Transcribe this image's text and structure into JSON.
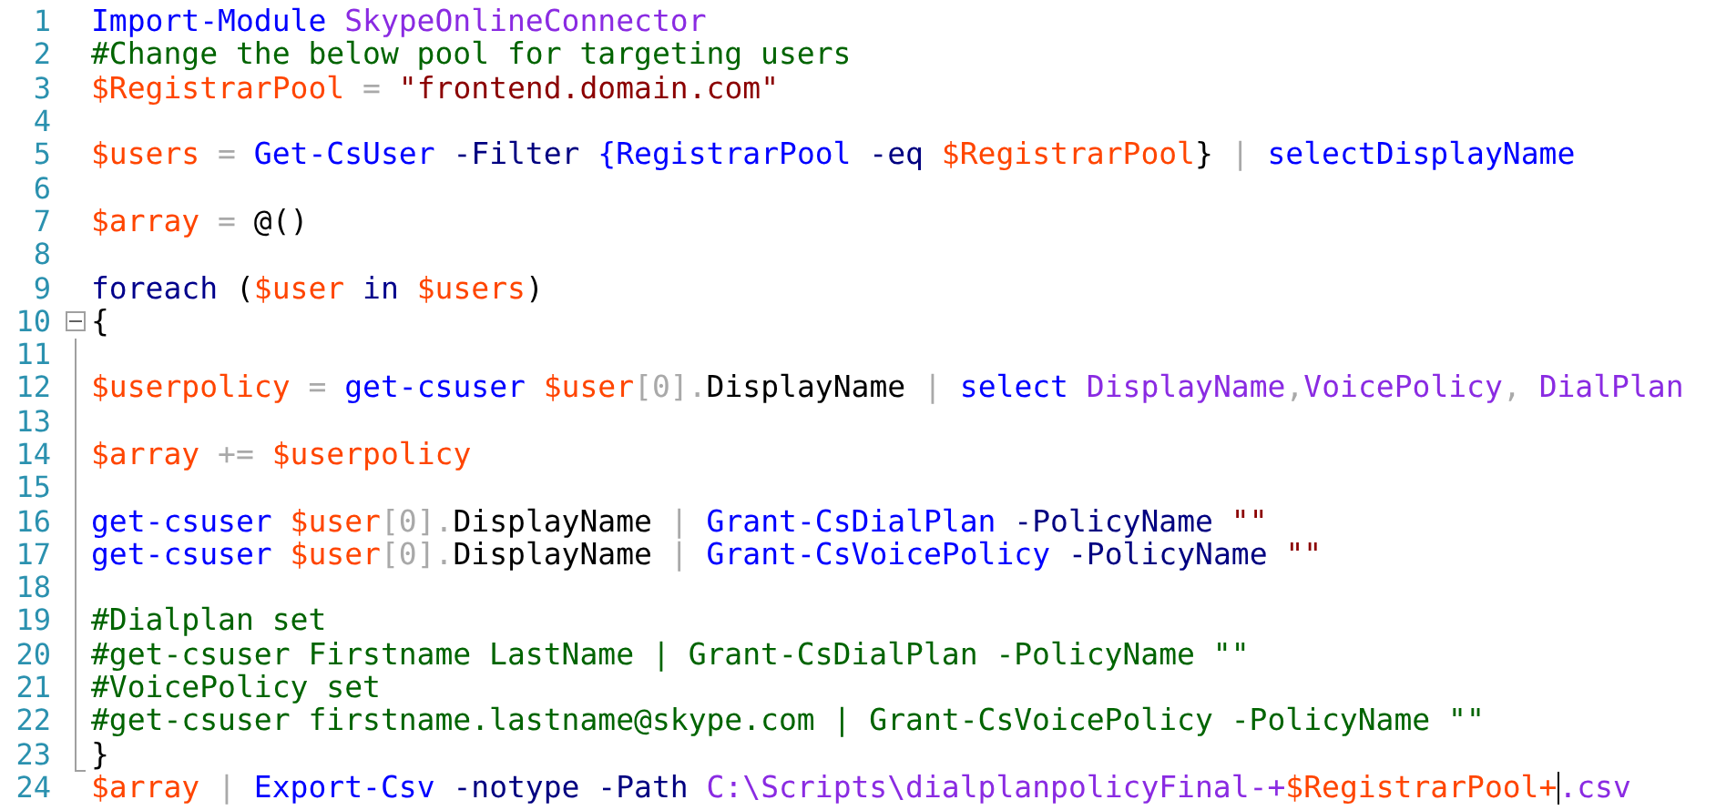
{
  "editor": {
    "lines": [
      {
        "number": "1",
        "kind": "plain",
        "tokens": [
          {
            "kind": "command",
            "text": "Import-Module"
          },
          {
            "kind": "argument",
            "text": " SkypeOnlineConnector"
          }
        ]
      },
      {
        "number": "2",
        "kind": "plain",
        "tokens": [
          {
            "kind": "comment",
            "text": "#Change the below pool for targeting users"
          }
        ]
      },
      {
        "number": "3",
        "kind": "plain",
        "tokens": [
          {
            "kind": "variable",
            "text": "$RegistrarPool"
          },
          {
            "kind": "operator",
            "text": " = "
          },
          {
            "kind": "string",
            "text": "\"frontend.domain.com\""
          }
        ]
      },
      {
        "number": "4",
        "kind": "plain"
      },
      {
        "number": "5",
        "kind": "plain",
        "tokens": [
          {
            "kind": "variable",
            "text": "$users"
          },
          {
            "kind": "operator",
            "text": " = "
          },
          {
            "kind": "command",
            "text": "Get-CsUser"
          },
          {
            "kind": "parameter",
            "text": " -Filter "
          },
          {
            "kind": "command",
            "text": "{RegistrarPool"
          },
          {
            "kind": "parameter",
            "text": " -eq "
          },
          {
            "kind": "variable",
            "text": "$RegistrarPool"
          },
          {
            "kind": "plain",
            "text": "}"
          },
          {
            "kind": "operator",
            "text": " | "
          },
          {
            "kind": "command",
            "text": "selectDisplayName"
          }
        ]
      },
      {
        "number": "6",
        "kind": "plain"
      },
      {
        "number": "7",
        "kind": "plain",
        "tokens": [
          {
            "kind": "variable",
            "text": "$array"
          },
          {
            "kind": "operator",
            "text": " = "
          },
          {
            "kind": "plain",
            "text": "@()"
          }
        ]
      },
      {
        "number": "8",
        "kind": "plain"
      },
      {
        "number": "9",
        "kind": "plain",
        "tokens": [
          {
            "kind": "keyword",
            "text": "foreach"
          },
          {
            "kind": "plain",
            "text": " ("
          },
          {
            "kind": "variable",
            "text": "$user"
          },
          {
            "kind": "keyword",
            "text": " in "
          },
          {
            "kind": "variable",
            "text": "$users"
          },
          {
            "kind": "plain",
            "text": ")"
          }
        ]
      },
      {
        "number": "10",
        "kind": "fold-start",
        "expanded": true,
        "tokens": [
          {
            "kind": "plain",
            "text": "{"
          }
        ]
      },
      {
        "number": "11",
        "kind": "fold-body"
      },
      {
        "number": "12",
        "kind": "fold-body",
        "tokens": [
          {
            "kind": "variable",
            "text": "$userpolicy"
          },
          {
            "kind": "operator",
            "text": " = "
          },
          {
            "kind": "command",
            "text": "get-csuser"
          },
          {
            "kind": "variable",
            "text": " $user"
          },
          {
            "kind": "operator",
            "text": "[0]."
          },
          {
            "kind": "plain",
            "text": "DisplayName"
          },
          {
            "kind": "operator",
            "text": " | "
          },
          {
            "kind": "command",
            "text": "select"
          },
          {
            "kind": "argument",
            "text": " DisplayName"
          },
          {
            "kind": "operator",
            "text": ","
          },
          {
            "kind": "argument",
            "text": "VoicePolicy"
          },
          {
            "kind": "operator",
            "text": ", "
          },
          {
            "kind": "argument",
            "text": "DialPlan"
          }
        ]
      },
      {
        "number": "13",
        "kind": "fold-body"
      },
      {
        "number": "14",
        "kind": "fold-body",
        "tokens": [
          {
            "kind": "variable",
            "text": "$array"
          },
          {
            "kind": "operator",
            "text": " += "
          },
          {
            "kind": "variable",
            "text": "$userpolicy"
          }
        ]
      },
      {
        "number": "15",
        "kind": "fold-body"
      },
      {
        "number": "16",
        "kind": "fold-body",
        "tokens": [
          {
            "kind": "command",
            "text": "get-csuser"
          },
          {
            "kind": "variable",
            "text": " $user"
          },
          {
            "kind": "operator",
            "text": "[0]."
          },
          {
            "kind": "plain",
            "text": "DisplayName"
          },
          {
            "kind": "operator",
            "text": " | "
          },
          {
            "kind": "command",
            "text": "Grant-CsDialPlan"
          },
          {
            "kind": "parameter",
            "text": " -PolicyName "
          },
          {
            "kind": "string",
            "text": "\"\""
          }
        ]
      },
      {
        "number": "17",
        "kind": "fold-body",
        "tokens": [
          {
            "kind": "command",
            "text": "get-csuser"
          },
          {
            "kind": "variable",
            "text": " $user"
          },
          {
            "kind": "operator",
            "text": "[0]."
          },
          {
            "kind": "plain",
            "text": "DisplayName"
          },
          {
            "kind": "operator",
            "text": " | "
          },
          {
            "kind": "command",
            "text": "Grant-CsVoicePolicy"
          },
          {
            "kind": "parameter",
            "text": " -PolicyName "
          },
          {
            "kind": "string",
            "text": "\"\""
          }
        ]
      },
      {
        "number": "18",
        "kind": "fold-body"
      },
      {
        "number": "19",
        "kind": "fold-body",
        "tokens": [
          {
            "kind": "comment",
            "text": "#Dialplan set"
          }
        ]
      },
      {
        "number": "20",
        "kind": "fold-body",
        "tokens": [
          {
            "kind": "comment",
            "text": "#get-csuser Firstname LastName | Grant-CsDialPlan -PolicyName \"\""
          }
        ]
      },
      {
        "number": "21",
        "kind": "fold-body",
        "tokens": [
          {
            "kind": "comment",
            "text": "#VoicePolicy set"
          }
        ]
      },
      {
        "number": "22",
        "kind": "fold-body",
        "tokens": [
          {
            "kind": "comment",
            "text": "#get-csuser firstname.lastname@skype.com | Grant-CsVoicePolicy -PolicyName \"\""
          }
        ]
      },
      {
        "number": "23",
        "kind": "fold-end",
        "tokens": [
          {
            "kind": "plain",
            "text": "}"
          }
        ]
      },
      {
        "number": "24",
        "kind": "plain",
        "tokens": [
          {
            "kind": "variable",
            "text": "$array"
          },
          {
            "kind": "operator",
            "text": " | "
          },
          {
            "kind": "command",
            "text": "Export-Csv"
          },
          {
            "kind": "parameter",
            "text": " -notype -Path "
          },
          {
            "kind": "argument",
            "text": "C:\\Scripts\\dialplanpolicyFinal-+"
          },
          {
            "kind": "variable",
            "text": "$RegistrarPool+"
          },
          {
            "kind": "argument",
            "text": ".csv",
            "cursor": true
          }
        ]
      }
    ]
  }
}
